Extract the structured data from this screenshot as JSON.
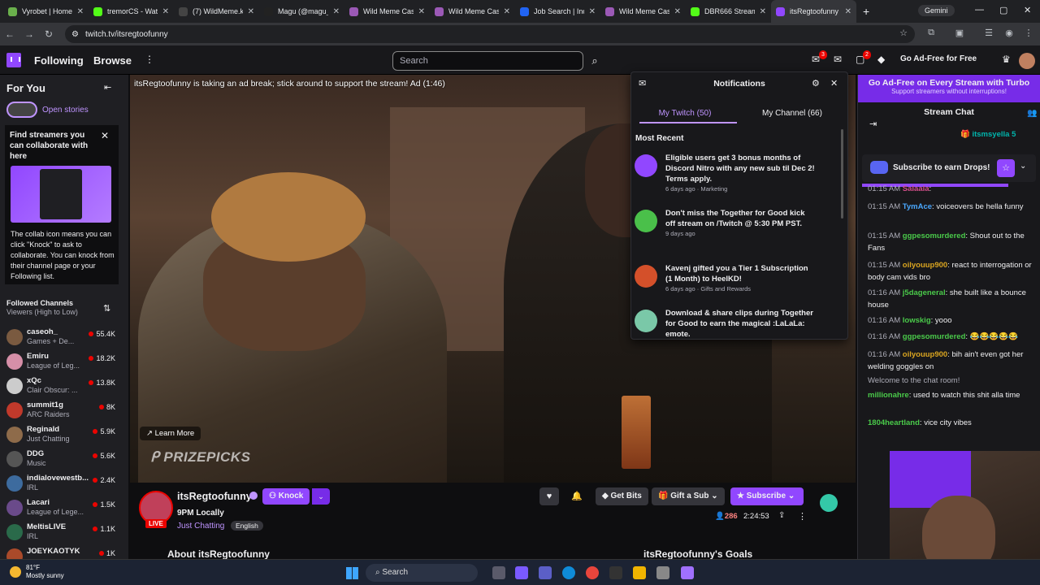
{
  "browser": {
    "tabs": [
      {
        "title": "Vyrobet | Home",
        "color": "#6ab04c"
      },
      {
        "title": "tremorCS - Wat",
        "color": "#53fc18"
      },
      {
        "title": "(7) WildMeme.k",
        "color": "#444444"
      },
      {
        "title": "Magu (@magu_",
        "color": "#222222"
      },
      {
        "title": "Wild Meme Cas",
        "color": "#9b59b6"
      },
      {
        "title": "Wild Meme Cas",
        "color": "#9b59b6"
      },
      {
        "title": "Job Search | Ind",
        "color": "#2164f3"
      },
      {
        "title": "Wild Meme Cas",
        "color": "#9b59b6"
      },
      {
        "title": "DBR666 Stream",
        "color": "#53fc18"
      },
      {
        "title": "itsRegtoofunny",
        "color": "#9147ff"
      }
    ],
    "new_tab": "+",
    "gemini": "Gemini",
    "url": "twitch.tv/itsregtoofunny"
  },
  "topnav": {
    "following": "Following",
    "browse": "Browse",
    "search_placeholder": "Search",
    "badge_inbox": "3",
    "badge_notif": "2",
    "ad_free": "Go Ad-Free for Free"
  },
  "sidebar": {
    "header": "For You",
    "stories": "Open stories",
    "promo_title": "Find streamers you can collaborate with here",
    "promo_desc": "The collab icon means you can click \"Knock\" to ask to collaborate. You can knock from their channel page or your Following list.",
    "followed_title": "Followed Channels",
    "followed_sub": "Viewers (High to Low)",
    "channels": [
      {
        "name": "caseoh_",
        "game": "Games + De...",
        "viewers": "55.4K",
        "color": "#7a5a40"
      },
      {
        "name": "Emiru",
        "game": "League of Leg...",
        "viewers": "18.2K",
        "color": "#d68fa8"
      },
      {
        "name": "xQc",
        "game": "Clair Obscur: ...",
        "viewers": "13.8K",
        "color": "#cccccc"
      },
      {
        "name": "summit1g",
        "game": "ARC Raiders",
        "viewers": "8K",
        "color": "#c0392b"
      },
      {
        "name": "Reginald",
        "game": "Just Chatting",
        "viewers": "5.9K",
        "color": "#8e6b4a"
      },
      {
        "name": "DDG",
        "game": "Music",
        "viewers": "5.6K",
        "color": "#555555"
      },
      {
        "name": "indialovewestb...",
        "game": "IRL",
        "viewers": "2.4K",
        "color": "#3d6b9e"
      },
      {
        "name": "Lacari",
        "game": "League of Lege...",
        "viewers": "1.5K",
        "color": "#6a4a8a"
      },
      {
        "name": "MeltisLIVE",
        "game": "IRL",
        "viewers": "1.1K",
        "color": "#2a6a4a"
      },
      {
        "name": "JOEYKAOTYK",
        "game": "",
        "viewers": "1K",
        "color": "#aa4a2a"
      }
    ]
  },
  "video": {
    "ad_text": "itsRegtoofunny is taking an ad break; stick around to support the stream! Ad (1:46)",
    "learn_more": "Learn More",
    "sponsor": "PRIZEPICKS"
  },
  "notifications": {
    "title": "Notifications",
    "tab1": "My Twitch (50)",
    "tab2": "My Channel (66)",
    "section": "Most Recent",
    "items": [
      {
        "text": "Eligible users get 3 bonus months of Discord Nitro with any new sub til Dec 2! Terms apply.",
        "meta": "6 days ago · Marketing",
        "color": "#9147ff"
      },
      {
        "text": "Don't miss the Together for Good kick off stream on /Twitch @ 5:30 PM PST.",
        "meta": "9 days ago",
        "color": "#4ac04a"
      },
      {
        "text": "Kavenj gifted you a Tier 1 Subscription (1 Month) to HeelKD!",
        "meta": "6 days ago · Gifts and Rewards",
        "color": "#d4502a"
      },
      {
        "text": "Download & share clips during Together for Good to earn the magical :LaLaLa: emote.",
        "meta": "",
        "color": "#7ac8a8"
      }
    ]
  },
  "channel": {
    "name": "itsRegtoofunny",
    "knock": "Knock",
    "title": "9PM Locally",
    "live": "LIVE",
    "category": "Just Chatting",
    "language": "English",
    "get_bits": "Get Bits",
    "gift_sub": "Gift a Sub",
    "subscribe": "Subscribe",
    "viewers": "286",
    "uptime": "2:24:53",
    "about": "About itsRegtoofunny",
    "goals": "itsRegtoofunny's Goals"
  },
  "chat": {
    "turbo_title": "Go Ad-Free on Every Stream with Turbo",
    "turbo_sub": "Support streamers without interruptions!",
    "header": "Stream Chat",
    "pinned_user": "itsmsyella",
    "pinned_count": "5",
    "drops": "Subscribe to earn Drops!",
    "messages": [
      {
        "ts": "01:15 AM",
        "user": "Salaala",
        "color": "#d44f8a",
        "text": ""
      },
      {
        "ts": "01:15 AM",
        "user": "TymAce",
        "color": "#4aa8ff",
        "text": "voiceovers be hella funny"
      },
      {
        "ts": "01:15 AM",
        "user": "ggpesomurdered",
        "color": "#4aca4a",
        "text": "Shout out to the Fans"
      },
      {
        "ts": "01:15 AM",
        "user": "oilyouup900",
        "color": "#daa520",
        "text": "react to interrogation or body cam vids bro"
      },
      {
        "ts": "01:16 AM",
        "user": "j5dageneral",
        "color": "#4aca4a",
        "text": "she built like a bounce house"
      },
      {
        "ts": "01:16 AM",
        "user": "lowskig",
        "color": "#4aca4a",
        "text": "yooo"
      },
      {
        "ts": "01:16 AM",
        "user": "ggpesomurdered",
        "color": "#4aca4a",
        "text": "😂😂😂😂😂"
      },
      {
        "ts": "01:16 AM",
        "user": "oilyouup900",
        "color": "#daa520",
        "text": "bih ain't even got her welding goggles on"
      },
      {
        "ts": "",
        "user": "",
        "color": "#adadb8",
        "text": "Welcome to the chat room!"
      },
      {
        "ts": "",
        "user": "millionahre",
        "color": "#4aca4a",
        "text": "used to watch this shit alla time"
      },
      {
        "ts": "",
        "user": "1804heartland",
        "color": "#4aca4a",
        "text": "vice city vibes"
      }
    ]
  },
  "taskbar": {
    "temp": "81°F",
    "weather": "Mostly sunny",
    "search": "Search"
  }
}
